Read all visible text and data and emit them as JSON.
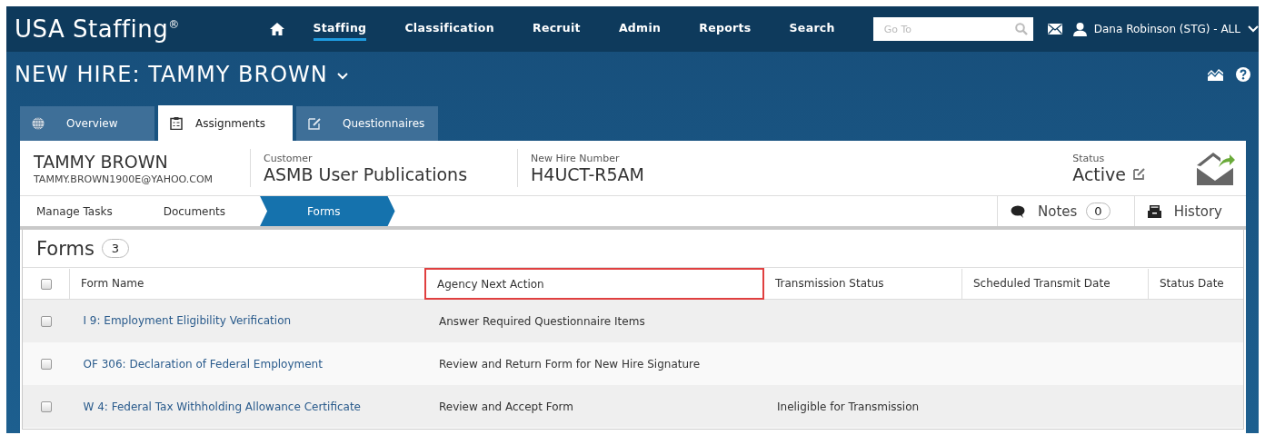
{
  "app": {
    "logo": "USA Staffing",
    "logo_mark": "®"
  },
  "nav": [
    {
      "label": "Staffing",
      "selected": true
    },
    {
      "label": "Classification",
      "selected": false
    },
    {
      "label": "Recruit",
      "selected": false
    },
    {
      "label": "Admin",
      "selected": false
    },
    {
      "label": "Reports",
      "selected": false
    },
    {
      "label": "Search",
      "selected": false
    }
  ],
  "goto": {
    "placeholder": "Go To"
  },
  "user": {
    "name": "Dana Robinson (STG) - ALL"
  },
  "page_title": "NEW HIRE: TAMMY BROWN",
  "tabs": [
    {
      "label": "Overview",
      "selected": false
    },
    {
      "label": "Assignments",
      "selected": true
    },
    {
      "label": "Questionnaires",
      "selected": false
    }
  ],
  "hire": {
    "name": "TAMMY BROWN",
    "email": "TAMMY.BROWN1900E@YAHOO.COM",
    "customer_label": "Customer",
    "customer": "ASMB User Publications",
    "number_label": "New Hire Number",
    "number": "H4UCT-R5AM",
    "status_label": "Status",
    "status": "Active"
  },
  "breadcrumb": [
    {
      "label": "Manage Tasks",
      "selected": false
    },
    {
      "label": "Documents",
      "selected": false
    },
    {
      "label": "Forms",
      "selected": true
    }
  ],
  "notes": {
    "label": "Notes",
    "count": "0"
  },
  "history": {
    "label": "History"
  },
  "forms": {
    "title": "Forms",
    "count": "3",
    "select_all_checked": false,
    "columns": [
      {
        "label": "Form Name",
        "highlighted": false
      },
      {
        "label": "Agency Next Action",
        "highlighted": true
      },
      {
        "label": "Transmission Status",
        "highlighted": false
      },
      {
        "label": "Scheduled Transmit Date",
        "highlighted": false
      },
      {
        "label": "Status Date",
        "highlighted": false
      }
    ],
    "rows": [
      {
        "checked": false,
        "form_name": "I 9: Employment Eligibility Verification",
        "agency_next_action": "Answer Required Questionnaire Items"
      },
      {
        "checked": false,
        "form_name": "OF 306: Declaration of Federal Employment",
        "agency_next_action": "Review and Return Form for New Hire Signature"
      },
      {
        "checked": false,
        "form_name": "W 4: Federal Tax Withholding Allowance Certificate",
        "agency_next_action": "Review and Accept Form",
        "transmission_status": "Ineligible for Transmission"
      }
    ]
  }
}
